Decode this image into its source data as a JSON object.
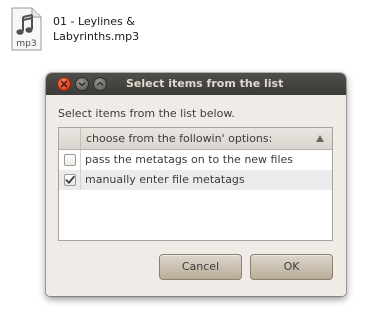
{
  "desktop": {
    "file_name": "01 - Leylines & Labyrinths.mp3",
    "file_name_line1": "01 - Leylines &",
    "file_name_line2": "Labyrinths.mp3",
    "file_type_badge": "mp3",
    "icon": "audio-file-icon"
  },
  "dialog": {
    "title": "Select items from the list",
    "window_buttons": [
      "close-icon",
      "minimize-icon",
      "maximize-icon"
    ],
    "prompt": "Select items from the list below.",
    "list": {
      "column_header": "choose from the followin' options:",
      "sort_indicator": "sort-ascending-icon",
      "items": [
        {
          "label": "pass the metatags on to the new files",
          "checked": false
        },
        {
          "label": "manually enter file metatags",
          "checked": true
        }
      ]
    },
    "buttons": {
      "cancel_label": "Cancel",
      "ok_label": "OK"
    }
  },
  "colors": {
    "titlebar": "#3c3b37",
    "close_button": "#e0411b",
    "dialog_background": "#efebe7",
    "button": "#c8bfb0"
  }
}
